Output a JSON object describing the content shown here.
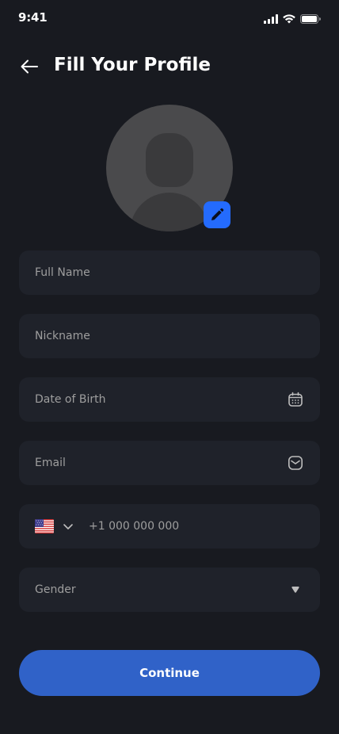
{
  "status_bar": {
    "time": "9:41",
    "icons": [
      "cellular-signal-icon",
      "wifi-icon",
      "battery-icon"
    ]
  },
  "header": {
    "title": "Fill Your Profile",
    "back_icon": "arrow-left-icon"
  },
  "avatar": {
    "edit_icon": "pencil-icon",
    "edit_button_color": "#246BFD"
  },
  "form": {
    "full_name": {
      "placeholder": "Full Name",
      "value": ""
    },
    "nickname": {
      "placeholder": "Nickname",
      "value": ""
    },
    "date_of_birth": {
      "placeholder": "Date of Birth",
      "value": "",
      "icon": "calendar-icon"
    },
    "email": {
      "placeholder": "Email",
      "value": "",
      "icon": "mail-icon"
    },
    "phone": {
      "placeholder": "+1 000 000 000",
      "value": "",
      "country_flag": "us-flag-icon",
      "chevron": "chevron-down-icon"
    },
    "gender": {
      "label": "Gender",
      "icon": "caret-down-icon"
    }
  },
  "actions": {
    "continue_label": "Continue",
    "continue_color": "#3062C8"
  },
  "colors": {
    "background": "#181A20",
    "field_background": "#1F222A",
    "placeholder": "#9E9E9E"
  }
}
